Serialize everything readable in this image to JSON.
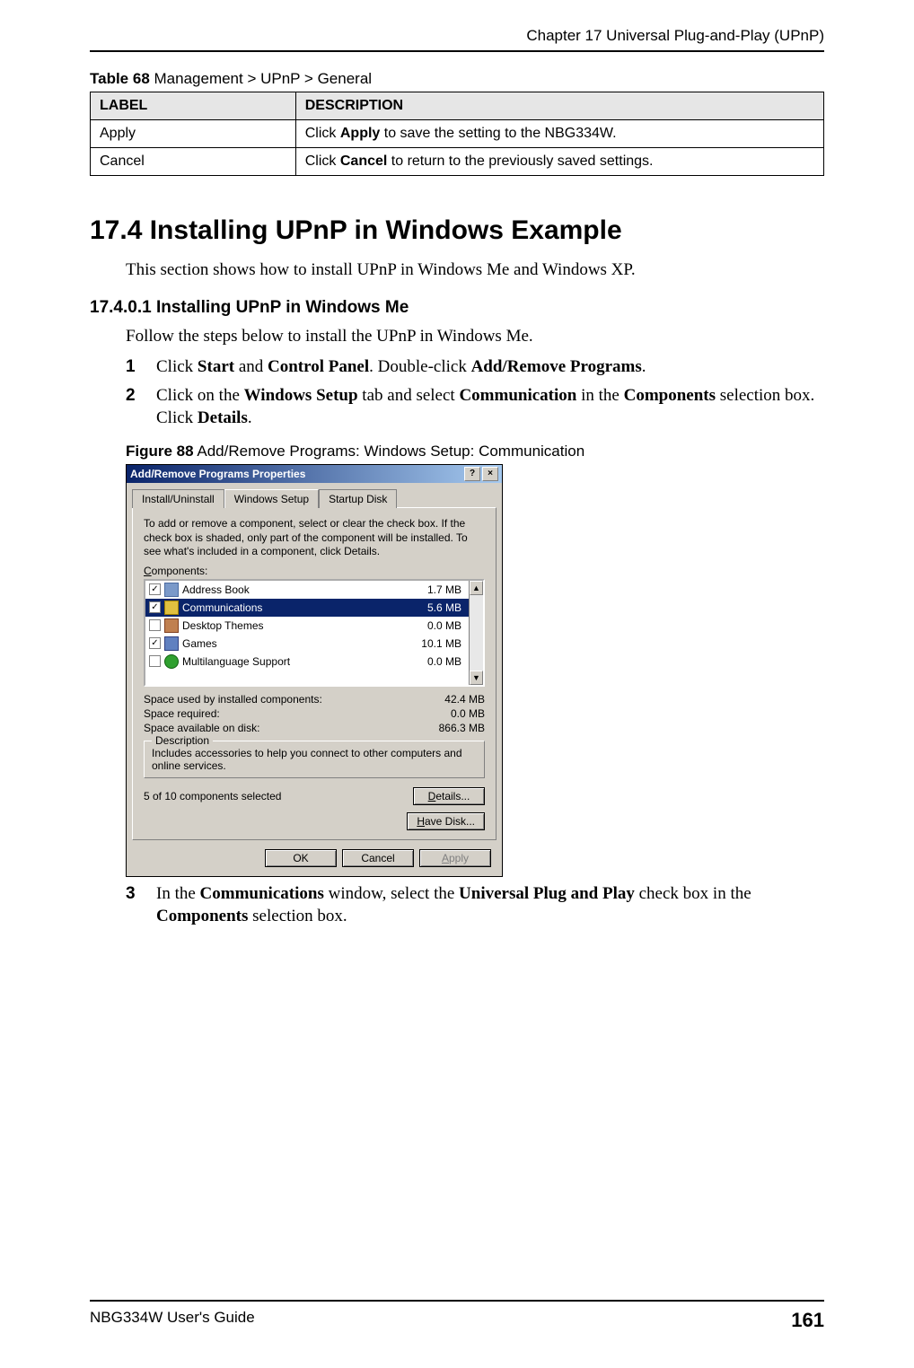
{
  "chapter_header": "Chapter 17 Universal Plug-and-Play (UPnP)",
  "table": {
    "caption_bold": "Table 68",
    "caption_rest": "   Management > UPnP > General",
    "headers": [
      "LABEL",
      "DESCRIPTION"
    ],
    "rows": [
      {
        "label": "Apply",
        "desc_pre": "Click ",
        "desc_bold": "Apply",
        "desc_post": " to save the setting to the NBG334W."
      },
      {
        "label": "Cancel",
        "desc_pre": "Click ",
        "desc_bold": "Cancel",
        "desc_post": " to return to the previously saved settings."
      }
    ]
  },
  "section": {
    "heading": "17.4  Installing UPnP in Windows Example",
    "intro": "This section shows how to install UPnP in Windows Me and Windows XP."
  },
  "subsection": {
    "heading": "17.4.0.1  Installing UPnP in Windows Me",
    "body": "Follow the steps below to install the UPnP in Windows Me.",
    "step1_num": "1",
    "step1_p1": "Click ",
    "step1_b1": "Start",
    "step1_p2": " and ",
    "step1_b2": "Control Panel",
    "step1_p3": ". Double-click ",
    "step1_b3": "Add/Remove Programs",
    "step1_p4": ".",
    "step2_num": "2",
    "step2_p1": "Click on the ",
    "step2_b1": "Windows Setup",
    "step2_p2": " tab and select ",
    "step2_b2": "Communication",
    "step2_p3": " in the ",
    "step2_b3": "Components",
    "step2_p4": " selection box. Click ",
    "step2_b4": "Details",
    "step2_p5": "."
  },
  "figure": {
    "caption_bold": "Figure 88",
    "caption_rest": "   Add/Remove Programs: Windows Setup: Communication"
  },
  "dialog": {
    "title": "Add/Remove Programs Properties",
    "help_btn": "?",
    "close_btn": "×",
    "tabs": {
      "install": "Install/Uninstall",
      "setup": "Windows Setup",
      "startup": "Startup Disk"
    },
    "instr": "To add or remove a component, select or clear the check box. If the check box is shaded, only part of the component will be installed. To see what's included in a component, click Details.",
    "components_label_u": "C",
    "components_label_rest": "omponents:",
    "items": [
      {
        "checked": "✓",
        "name": "Address Book",
        "size": "1.7 MB",
        "icn": "book"
      },
      {
        "checked": "✓",
        "name": "Communications",
        "size": "5.6 MB",
        "icn": "comm",
        "selected": true
      },
      {
        "checked": "",
        "name": "Desktop Themes",
        "size": "0.0 MB",
        "icn": "dtheme"
      },
      {
        "checked": "✓",
        "name": "Games",
        "size": "10.1 MB",
        "icn": "games"
      },
      {
        "checked": "",
        "name": "Multilanguage Support",
        "size": "0.0 MB",
        "icn": "multi"
      }
    ],
    "scroll_up": "▲",
    "scroll_down": "▼",
    "kv": {
      "used_lbl": "Space used by installed components:",
      "used_val": "42.4 MB",
      "req_lbl": "Space required:",
      "req_val": "0.0 MB",
      "avail_lbl": "Space available on disk:",
      "avail_val": "866.3 MB"
    },
    "desc_text": "Includes accessories to help you connect to other computers and online services.",
    "selected_text": "5 of 10 components selected",
    "details_btn_u": "D",
    "details_btn_rest": "etails...",
    "havedisk_btn_u": "H",
    "havedisk_btn_rest": "ave Disk...",
    "ok_btn": "OK",
    "cancel_btn": "Cancel",
    "apply_btn_u": "A",
    "apply_btn_rest": "pply"
  },
  "step3": {
    "num": "3",
    "p1": "In the ",
    "b1": "Communications",
    "p2": " window, select the ",
    "b2": "Universal Plug and Play",
    "p3": " check box in the ",
    "b3": "Components",
    "p4": " selection box."
  },
  "footer": {
    "guide": "NBG334W User's Guide",
    "page": "161"
  }
}
